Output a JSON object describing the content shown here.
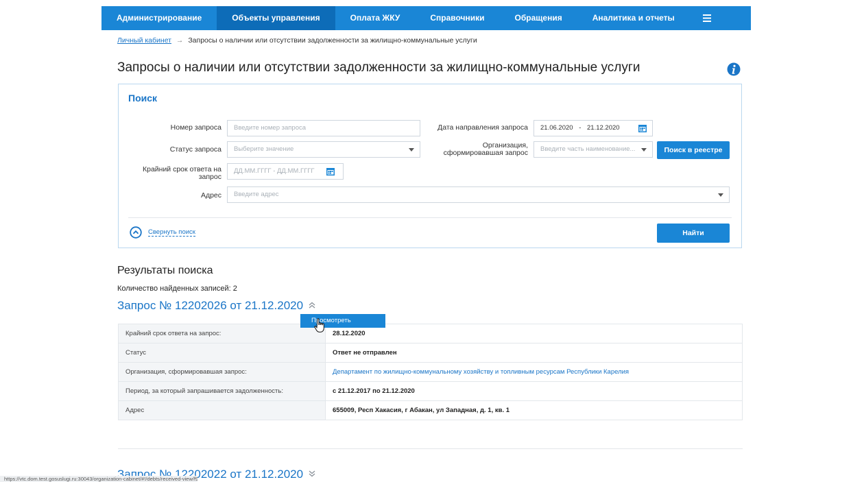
{
  "nav": {
    "items": [
      {
        "label": "Администрирование",
        "active": false
      },
      {
        "label": "Объекты управления",
        "active": true
      },
      {
        "label": "Оплата ЖКУ",
        "active": false
      },
      {
        "label": "Справочники",
        "active": false
      },
      {
        "label": "Обращения",
        "active": false
      },
      {
        "label": "Аналитика и отчеты",
        "active": false
      }
    ],
    "menu_icon": "hamburger-icon"
  },
  "breadcrumb": {
    "home": "Личный кабинет",
    "separator": "→",
    "current": "Запросы о наличии или отсутствии задолженности за жилищно-коммунальные услуги"
  },
  "page": {
    "title": "Запросы о наличии или отсутствии задолженности за жилищно-коммунальные услуги",
    "info_icon": "info-icon"
  },
  "search": {
    "title": "Поиск",
    "request_number": {
      "label": "Номер запроса",
      "placeholder": "Введите номер запроса"
    },
    "request_date": {
      "label": "Дата направления запроса",
      "from": "21.06.2020",
      "sep": "-",
      "to": "21.12.2020"
    },
    "status": {
      "label": "Статус запроса",
      "placeholder": "Выберите значение"
    },
    "organization": {
      "label": "Организация, сформировавшая запрос",
      "placeholder": "Введите часть наименование..."
    },
    "registry_button": "Поиск в реестре",
    "deadline": {
      "label": "Крайний срок ответа на запрос",
      "placeholder": "ДД.ММ.ГГГГ  -  ДД.ММ.ГГГГ"
    },
    "address": {
      "label": "Адрес",
      "placeholder": "Введите адрес"
    },
    "collapse_label": "Свернуть поиск",
    "find_button": "Найти"
  },
  "results": {
    "title": "Результаты поиска",
    "count_text": "Количество найденных записей: 2",
    "items": [
      {
        "title": "Запрос № 12202026 от 21.12.2020",
        "tooltip": "Просмотреть",
        "rows": [
          {
            "key": "Крайний срок ответа на запрос:",
            "value": "28.12.2020"
          },
          {
            "key": "Статус",
            "value": "Ответ не отправлен"
          },
          {
            "key": "Организация, сформировавшая запрос:",
            "value": "Департамент по жилищно-коммунальному хозяйству и топливным ресурсам Республики Карелия"
          },
          {
            "key": "Период, за который запрашивается задолженность:",
            "value": "с 21.12.2017 по 21.12.2020"
          },
          {
            "key": "Адрес",
            "value": "655009, Респ Хакасия, г Абакан, ул Западная, д. 1, кв. 1"
          }
        ]
      },
      {
        "title": "Запрос № 12202022 от 21.12.2020"
      }
    ]
  },
  "statusbar": {
    "url": "https://vtc.dom.test.gosuslugi.ru:30043/organization-cabinet/#!/debts/received-view/f9af2e75-4..."
  },
  "colors": {
    "accent": "#1a86d6",
    "link": "#1a75c7",
    "active_nav": "#0d6cb8"
  }
}
